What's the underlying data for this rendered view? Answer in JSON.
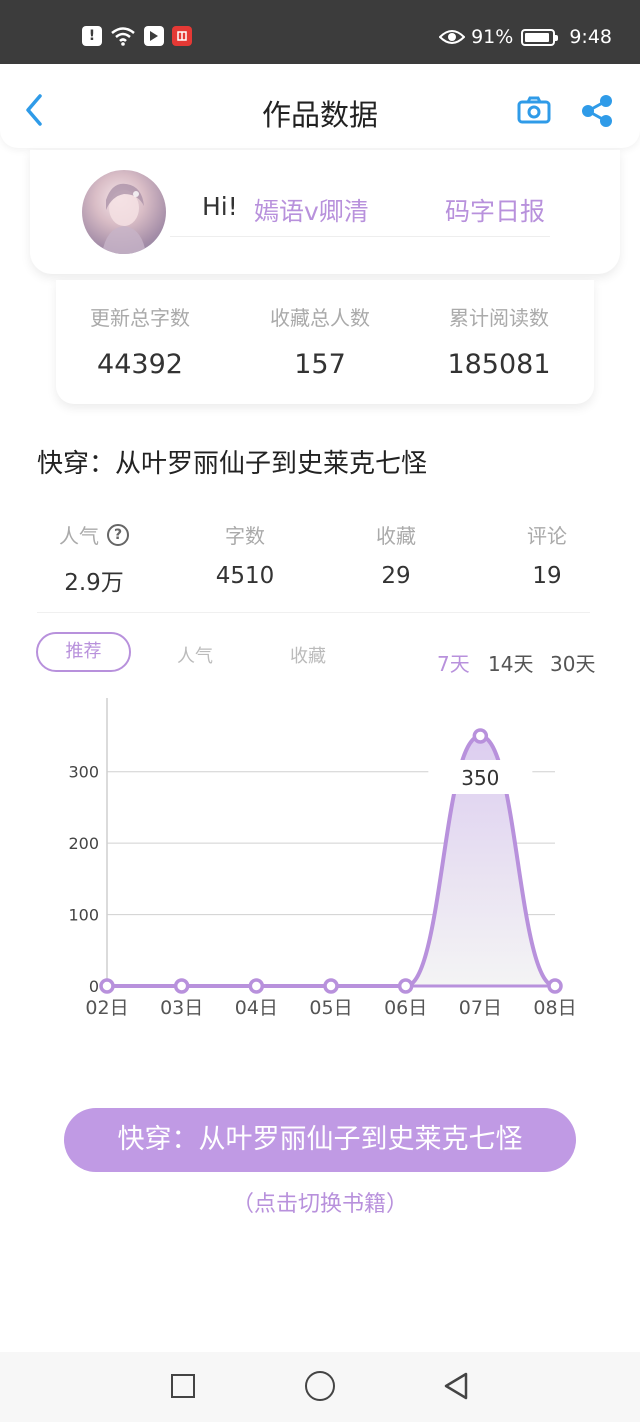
{
  "status_bar": {
    "battery_percent": "91%",
    "battery_level": 0.91,
    "time": "9:48",
    "icons": [
      "alert-icon",
      "wifi-icon",
      "nav-app-icon",
      "book-app-icon",
      "eye-icon",
      "battery-icon"
    ]
  },
  "header": {
    "title": "作品数据",
    "back_icon": "chevron-left-icon",
    "camera_icon": "camera-icon",
    "share_icon": "share-icon",
    "accent_color": "#2f9be8"
  },
  "profile": {
    "greeting": "Hi!",
    "username": "嫣语v卿清",
    "daily_report": "码字日报"
  },
  "totals": [
    {
      "label": "更新总字数",
      "value": "44392"
    },
    {
      "label": "收藏总人数",
      "value": "157"
    },
    {
      "label": "累计阅读数",
      "value": "185081"
    }
  ],
  "book": {
    "title": "快穿：从叶罗丽仙子到史莱克七怪"
  },
  "stats": [
    {
      "label": "人气",
      "value": "2.9万",
      "help_icon": "?"
    },
    {
      "label": "字数",
      "value": "4510"
    },
    {
      "label": "收藏",
      "value": "29"
    },
    {
      "label": "评论",
      "value": "19"
    }
  ],
  "tabs": {
    "active": "推荐",
    "items": [
      "推荐",
      "人气",
      "收藏"
    ]
  },
  "ranges": {
    "active": "7天",
    "items": [
      "7天",
      "14天",
      "30天"
    ]
  },
  "chart_data": {
    "type": "area",
    "categories": [
      "02日",
      "03日",
      "04日",
      "05日",
      "06日",
      "07日",
      "08日"
    ],
    "values": [
      0,
      0,
      0,
      0,
      0,
      350,
      0
    ],
    "yticks": [
      "0",
      "100",
      "200",
      "300"
    ],
    "ylim": [
      0,
      350
    ],
    "grid": true,
    "highlight_label": "350",
    "color": "#b891dc"
  },
  "bottom": {
    "book_button": "快穿：从叶罗丽仙子到史莱克七怪",
    "switch_hint": "（点击切换书籍）"
  },
  "nav": {
    "icons": [
      "square-icon",
      "circle-icon",
      "triangle-back-icon"
    ]
  },
  "colors": {
    "accent": "#b891dc",
    "button": "#c09ae4",
    "status_bar": "#3c3c3c"
  }
}
